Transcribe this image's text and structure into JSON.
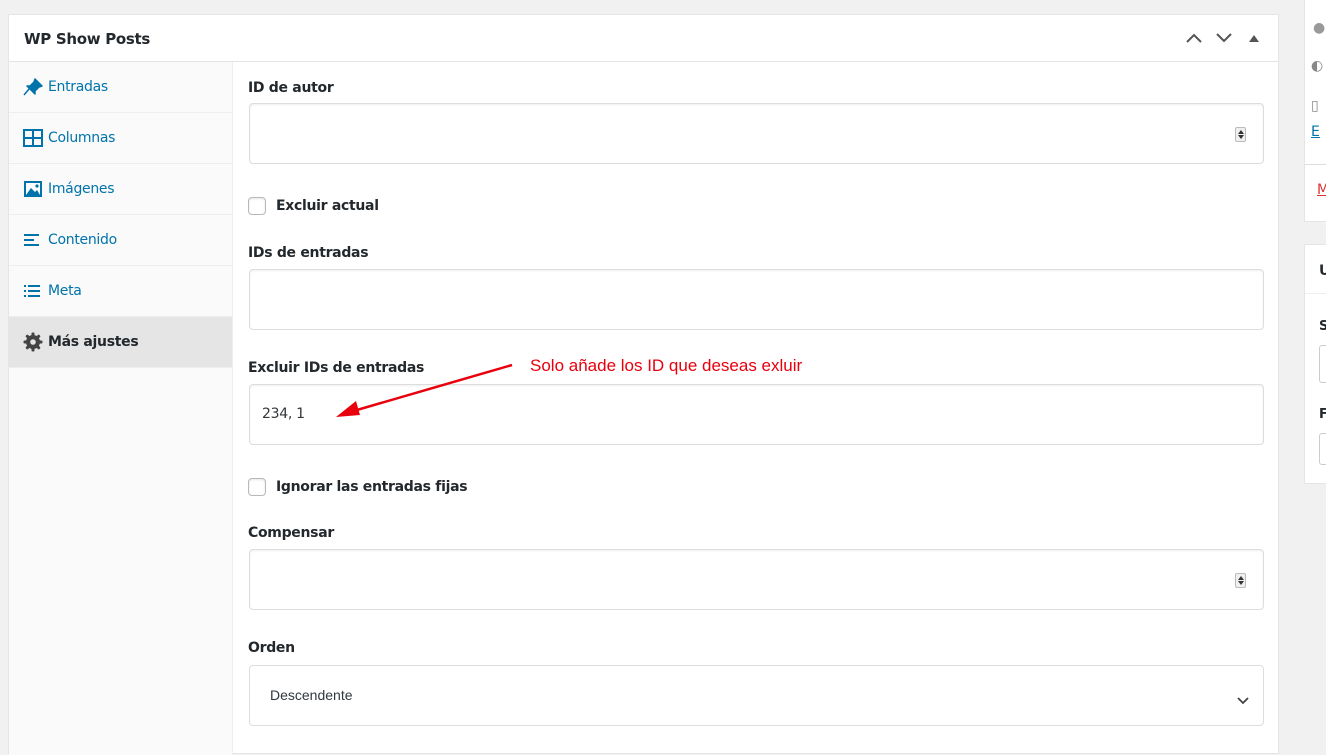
{
  "metabox": {
    "title": "WP Show Posts",
    "controls": [
      "chevron-up-icon",
      "chevron-down-icon",
      "triangle-up-icon"
    ]
  },
  "tabs": [
    {
      "label": "Entradas",
      "icon": "pin-icon"
    },
    {
      "label": "Columnas",
      "icon": "columns-icon"
    },
    {
      "label": "Imágenes",
      "icon": "image-icon"
    },
    {
      "label": "Contenido",
      "icon": "align-left-icon"
    },
    {
      "label": "Meta",
      "icon": "list-icon"
    },
    {
      "label": "Más ajustes",
      "icon": "gear-icon",
      "active": true
    }
  ],
  "fields": {
    "author_id": {
      "label": "ID de autor",
      "value": ""
    },
    "exclude_current": {
      "label": "Excluir actual",
      "checked": false
    },
    "post_ids": {
      "label": "IDs de entradas",
      "value": ""
    },
    "exclude_post_ids": {
      "label": "Excluir IDs de entradas",
      "value": "234, 1"
    },
    "ignore_sticky": {
      "label": "Ignorar las entradas fijas",
      "checked": false
    },
    "offset": {
      "label": "Compensar",
      "value": ""
    },
    "order": {
      "label": "Orden",
      "selected": "Descendente"
    }
  },
  "annotation": {
    "text": "Solo añade los ID que deseas exluir",
    "color": "#e8000d"
  },
  "right_panel": {
    "letters": [
      "E",
      "M",
      "U",
      "S",
      "F"
    ]
  },
  "colors": {
    "link": "#0073aa",
    "text": "#23282d",
    "accent_red": "#dc3232"
  }
}
